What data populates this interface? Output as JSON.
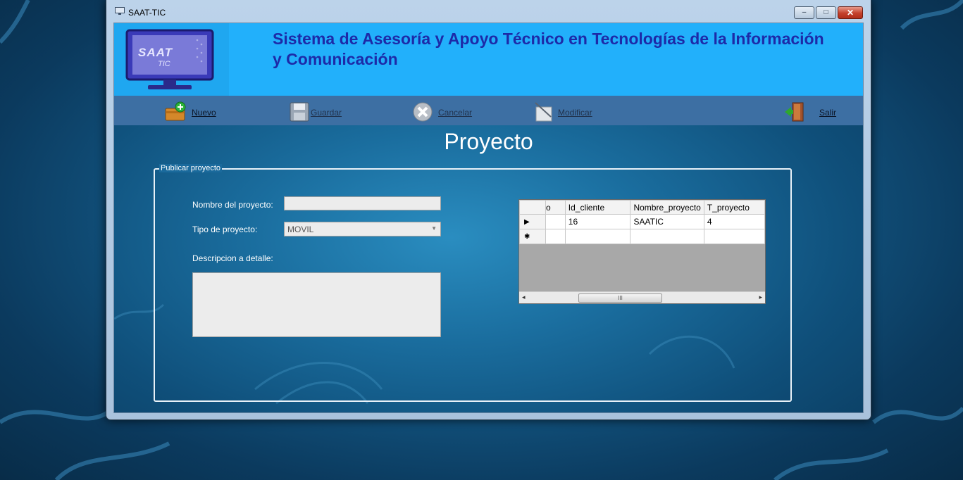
{
  "window": {
    "title": "SAAT-TIC",
    "min_label": "‒",
    "max_label": "□",
    "close_label": "✕"
  },
  "header": {
    "logo_text": "SAAT",
    "logo_subtext": "TIC",
    "title": "Sistema de Asesoría y Apoyo Técnico en Tecnologías de la Información y Comunicación"
  },
  "toolbar": {
    "nuevo": "Nuevo",
    "guardar": "Guardar",
    "cancelar": "Cancelar",
    "modificar": "Modificar",
    "salir": "Salir"
  },
  "page": {
    "title": "Proyecto"
  },
  "form": {
    "group_label": "Publicar proyecto",
    "nombre_label": "Nombre del proyecto:",
    "nombre_value": "",
    "tipo_label": "Tipo de proyecto:",
    "tipo_value": "MOVIL",
    "descripcion_label": "Descripcion a detalle:",
    "descripcion_value": ""
  },
  "grid": {
    "columns": [
      "o",
      "Id_cliente",
      "Nombre_proyecto",
      "T_proyecto"
    ],
    "rows": [
      {
        "marker": "▶",
        "cells": [
          "",
          "16",
          "SAATIC",
          "4"
        ]
      },
      {
        "marker": "✱",
        "cells": [
          "",
          "",
          "",
          ""
        ]
      }
    ],
    "scroll_left": "◂",
    "scroll_right": "▸",
    "scroll_grip": "III"
  },
  "colors": {
    "header_bg": "#22b0fb",
    "toolbar_bg": "#3d6fa3",
    "title_text": "#1d2aa8"
  }
}
